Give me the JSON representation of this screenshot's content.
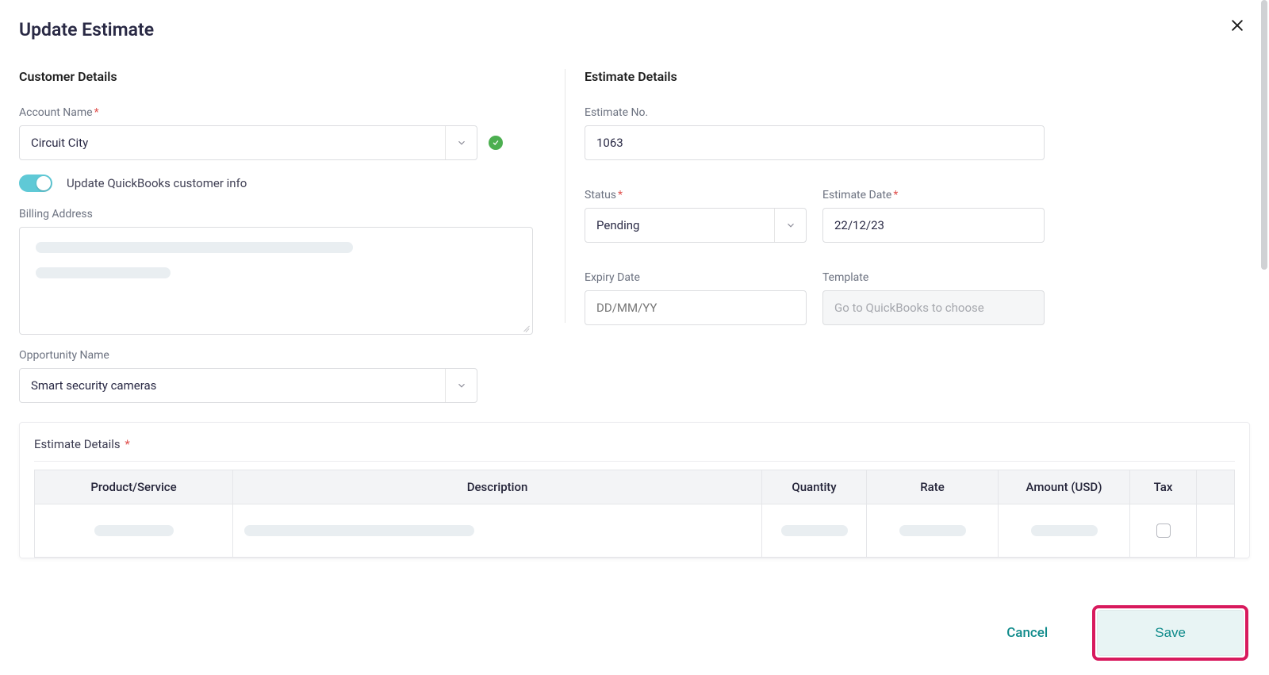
{
  "page": {
    "title": "Update Estimate"
  },
  "customer": {
    "section_title": "Customer Details",
    "account_name_label": "Account Name",
    "account_name_value": "Circuit City",
    "update_qb_label": "Update QuickBooks customer info",
    "update_qb_on": true,
    "billing_address_label": "Billing Address",
    "billing_address_value": "",
    "opportunity_label": "Opportunity Name",
    "opportunity_value": "Smart security cameras"
  },
  "estimate": {
    "section_title": "Estimate Details",
    "no_label": "Estimate No.",
    "no_value": "1063",
    "status_label": "Status",
    "status_value": "Pending",
    "date_label": "Estimate Date",
    "date_value": "22/12/23",
    "expiry_label": "Expiry Date",
    "expiry_placeholder": "DD/MM/YY",
    "expiry_value": "",
    "template_label": "Template",
    "template_placeholder": "Go to QuickBooks to choose"
  },
  "line_items": {
    "title": "Estimate Details",
    "columns": {
      "product": "Product/Service",
      "description": "Description",
      "quantity": "Quantity",
      "rate": "Rate",
      "amount": "Amount (USD)",
      "tax": "Tax"
    },
    "rows": [
      {
        "product": "",
        "description": "",
        "quantity": "",
        "rate": "",
        "amount": "",
        "tax_checked": false
      }
    ]
  },
  "footer": {
    "cancel": "Cancel",
    "save": "Save"
  }
}
